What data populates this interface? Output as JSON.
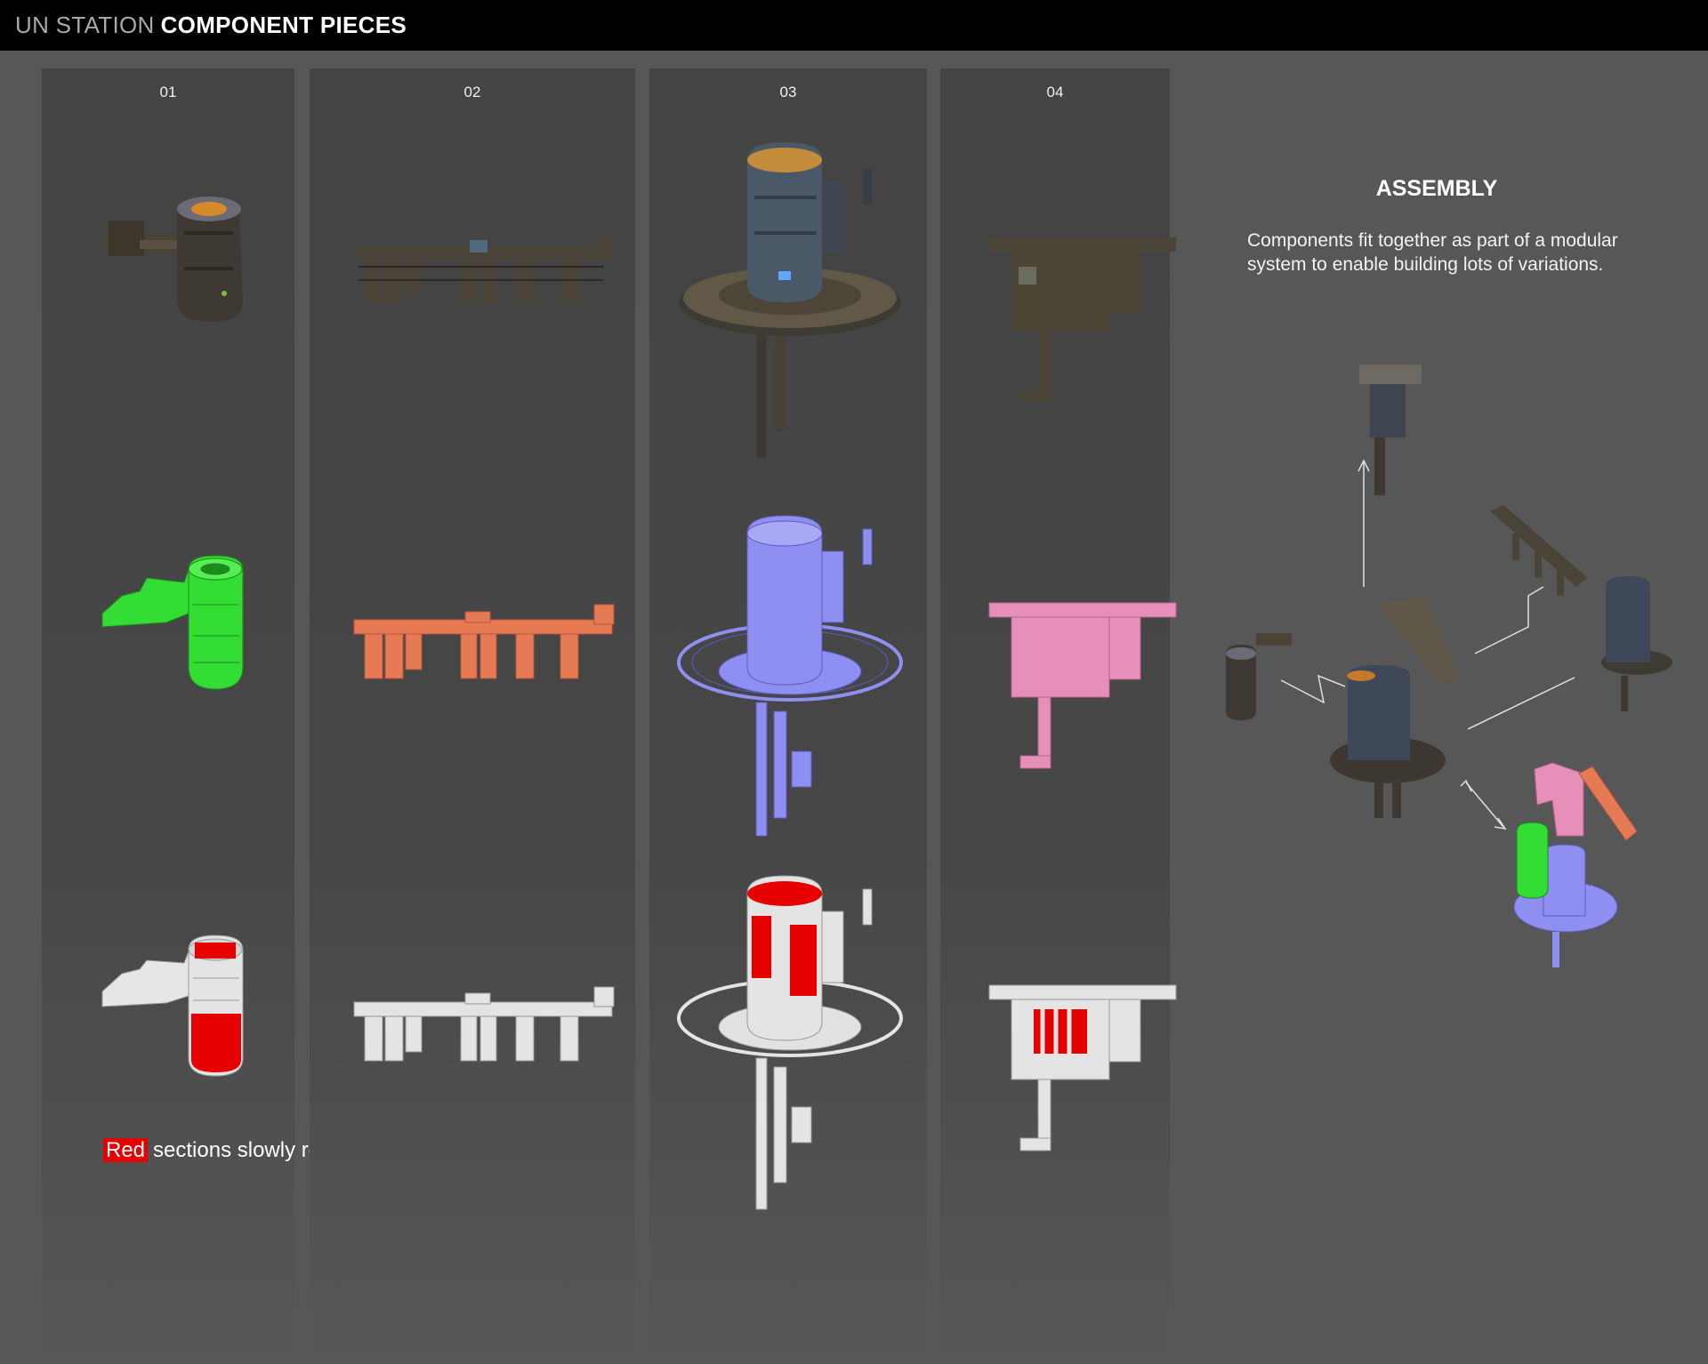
{
  "header": {
    "title_prefix": "UN STATION",
    "title_main": "COMPONENT PIECES"
  },
  "columns": [
    {
      "number": "01"
    },
    {
      "number": "02"
    },
    {
      "number": "03"
    },
    {
      "number": "04"
    }
  ],
  "assembly": {
    "heading": "ASSEMBLY",
    "text_line_1": "Components fit together as part of a modular",
    "text_line_2": "system to enable building lots of variations."
  },
  "note": {
    "highlight": "Red",
    "rest": "sections slowly rotate"
  },
  "colors": {
    "background": "#575757",
    "header_bar": "#000000",
    "column_panel": "#454545",
    "highlight_red": "#e60000",
    "piece_01": "#33dd33",
    "piece_02": "#e67a55",
    "piece_03": "#8f8ff2",
    "piece_04": "#e68fb8"
  }
}
